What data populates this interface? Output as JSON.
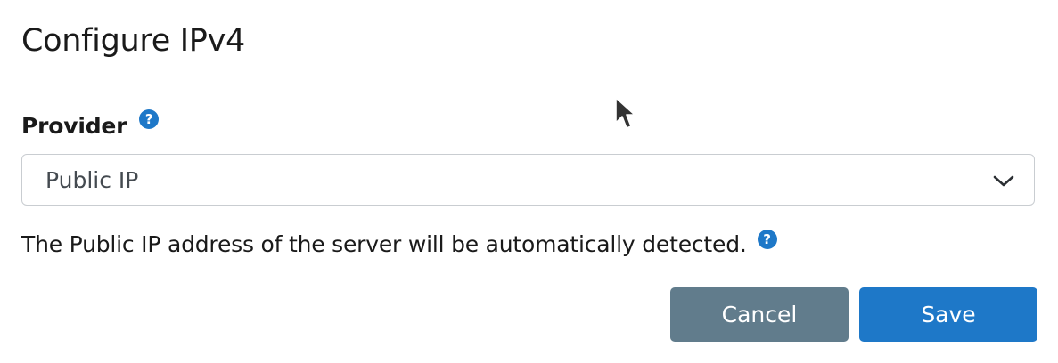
{
  "dialog": {
    "title": "Configure IPv4"
  },
  "provider": {
    "label": "Provider",
    "help_glyph": "?",
    "help_icon": "question-circle-icon",
    "selected_value": "Public IP",
    "chevron_icon": "chevron-down-icon"
  },
  "description": {
    "text": "The Public IP address of the server will be automatically detected.",
    "help_glyph": "?",
    "help_icon": "question-circle-icon"
  },
  "actions": {
    "cancel_label": "Cancel",
    "save_label": "Save"
  },
  "colors": {
    "primary": "#1e78c8",
    "secondary": "#617c8c",
    "text": "#1a1a1a",
    "border": "#c9cdd1"
  }
}
